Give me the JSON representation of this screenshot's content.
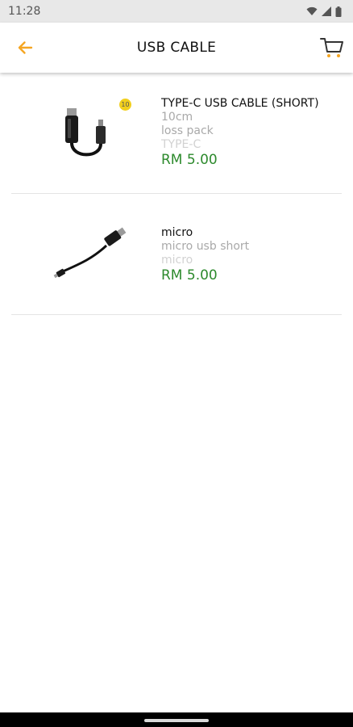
{
  "status_bar": {
    "time": "11:28"
  },
  "header": {
    "title": "USB CABLE",
    "back_icon": "arrow-left-icon",
    "cart_icon": "cart-icon",
    "accent_color": "#f5a623"
  },
  "products": [
    {
      "name": "TYPE-C USB CABLE (SHORT)",
      "description_lines": [
        "10cm",
        "loss pack"
      ],
      "category": "TYPE-C",
      "price": "RM 5.00",
      "cart_qty": "10"
    },
    {
      "name": "micro",
      "description_lines": [
        "micro usb short"
      ],
      "category": "micro",
      "price": "RM 5.00"
    }
  ],
  "colors": {
    "price": "#2d8a2d",
    "badge": "#f2cf1d"
  }
}
